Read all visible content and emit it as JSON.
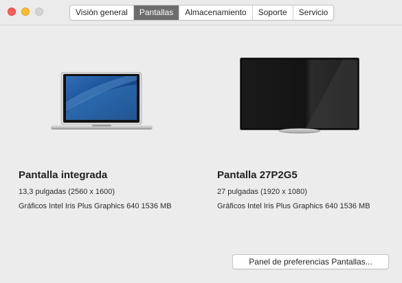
{
  "tabs": [
    {
      "label": "Visión general",
      "active": false
    },
    {
      "label": "Pantallas",
      "active": true
    },
    {
      "label": "Almacenamiento",
      "active": false
    },
    {
      "label": "Soporte",
      "active": false
    },
    {
      "label": "Servicio",
      "active": false
    }
  ],
  "displays": [
    {
      "name": "Pantalla integrada",
      "size": "13,3 pulgadas (2560 x 1600)",
      "graphics": "Gráficos Intel Iris Plus Graphics 640 1536 MB",
      "icon": "laptop-icon"
    },
    {
      "name": "Pantalla 27P2G5",
      "size": "27 pulgadas (1920 x 1080)",
      "graphics": "Gráficos Intel Iris Plus Graphics 640 1536 MB",
      "icon": "monitor-icon"
    }
  ],
  "prefs_button": {
    "label": "Panel de preferencias Pantallas..."
  },
  "colors": {
    "accent_tab": "#6c6c6c",
    "close": "#fe5f57",
    "minimize": "#febc2e",
    "maximize": "#d4d4d4"
  }
}
